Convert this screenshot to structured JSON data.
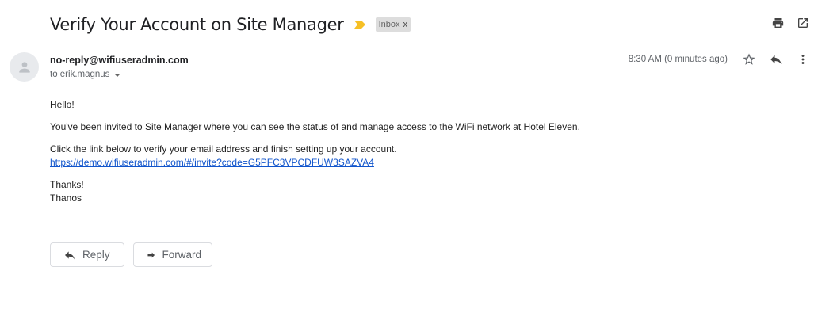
{
  "email": {
    "subject": "Verify Your Account on Site Manager",
    "label": "Inbox",
    "label_close": "x",
    "sender": "no-reply@wifiuseradmin.com",
    "recipient": "to erik.magnus",
    "timestamp": "8:30 AM (0 minutes ago)",
    "body": {
      "greeting": "Hello!",
      "line1": "You've been invited to Site Manager where you can see the status of and manage access to the WiFi network at Hotel Eleven.",
      "line2": "Click the link below to verify your email address and finish setting up your account.",
      "link": "https://demo.wifiuseradmin.com/#/invite?code=G5PFC3VPCDFUW3SAZVA4",
      "signoff": "Thanks!",
      "signature": "Thanos"
    }
  },
  "actions": {
    "reply_label": "Reply",
    "forward_label": "Forward"
  },
  "icons": {
    "importance": "importance-marker-icon",
    "print": "print-icon",
    "open_new_window": "open-in-new-window-icon",
    "star": "star-icon",
    "reply": "reply-icon",
    "more": "more-vertical-icon",
    "avatar": "person-icon",
    "forward": "forward-icon"
  },
  "colors": {
    "importance": "#f6c026",
    "link": "#1155cc",
    "label_bg": "#dddddd"
  }
}
